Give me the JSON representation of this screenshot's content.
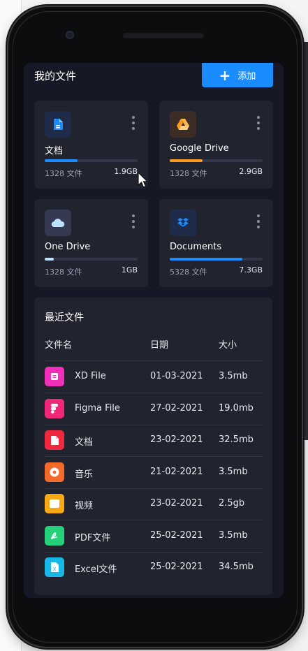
{
  "header": {
    "title": "我的文件",
    "add_label": "添加"
  },
  "cards": [
    {
      "name": "文档",
      "count": "1328 文件",
      "size": "1.9GB",
      "progress": 0.35,
      "color": "#1a8cff",
      "icon": "document-icon"
    },
    {
      "name": "Google Drive",
      "count": "1328 文件",
      "size": "2.9GB",
      "progress": 0.35,
      "color": "#ff9a1f",
      "icon": "google-drive-icon"
    },
    {
      "name": "One Drive",
      "count": "1328 文件",
      "size": "1GB",
      "progress": 0.1,
      "color": "#bfe0ff",
      "icon": "onedrive-cloud-icon"
    },
    {
      "name": "Documents",
      "count": "5328 文件",
      "size": "7.3GB",
      "progress": 0.78,
      "color": "#1a8cff",
      "icon": "dropbox-icon"
    }
  ],
  "recent": {
    "title": "最近文件",
    "columns": {
      "name": "文件名",
      "date": "日期",
      "size": "大小"
    },
    "rows": [
      {
        "name": "XD File",
        "date": "01-03-2021",
        "size": "3.5mb",
        "color": "#f030b8",
        "icon": "xd-file-icon"
      },
      {
        "name": "Figma File",
        "date": "27-02-2021",
        "size": "19.0mb",
        "color": "#f0287a",
        "icon": "figma-icon"
      },
      {
        "name": "文档",
        "date": "23-02-2021",
        "size": "32.5mb",
        "color": "#f0293e",
        "icon": "document-file-icon"
      },
      {
        "name": "音乐",
        "date": "21-02-2021",
        "size": "3.5mb",
        "color": "#f46a2a",
        "icon": "music-icon"
      },
      {
        "name": "视频",
        "date": "23-02-2021",
        "size": "2.5gb",
        "color": "#f7a814",
        "icon": "video-icon"
      },
      {
        "name": "PDF文件",
        "date": "25-02-2021",
        "size": "3.5mb",
        "color": "#24d17a",
        "icon": "pdf-icon"
      },
      {
        "name": "Excel文件",
        "date": "25-02-2021",
        "size": "34.5mb",
        "color": "#19b7e6",
        "icon": "excel-icon"
      }
    ]
  }
}
